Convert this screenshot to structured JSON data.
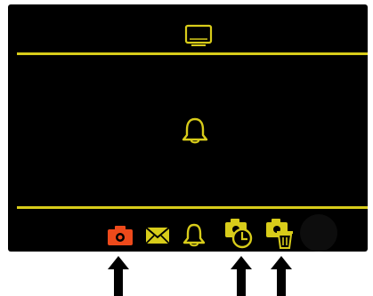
{
  "colors": {
    "screen_bg": "#000000",
    "accent_yellow": "#d8cc1a",
    "active_orange": "#ee4a1b",
    "arrow": "#000000"
  },
  "top_bar": {
    "icon": "tv-icon"
  },
  "main": {
    "icon": "bell-icon"
  },
  "bottom_bar": {
    "items": [
      {
        "icon": "camera-icon",
        "selected": true
      },
      {
        "icon": "mail-icon",
        "selected": false
      },
      {
        "icon": "bell-icon",
        "selected": false
      },
      {
        "icon": "camera-clock-icon",
        "selected": false
      },
      {
        "icon": "camera-trash-icon",
        "selected": false
      }
    ]
  },
  "annotations": {
    "arrows": [
      "up-arrow-icon",
      "up-arrow-icon",
      "up-arrow-icon"
    ]
  }
}
